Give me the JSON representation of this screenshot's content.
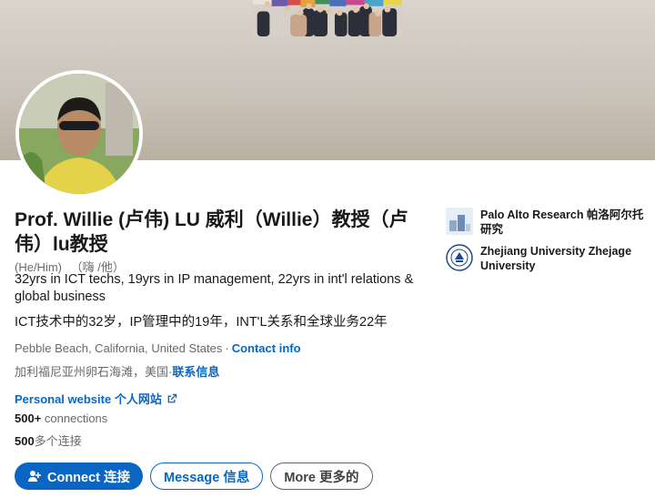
{
  "profile": {
    "name": "Prof. Willie (卢伟) LU 威利（Willie）教授（卢伟）lu教授",
    "pronouns": "(He/Him)",
    "pronouns_cn": "（嗨 /他）",
    "headline": "32yrs in ICT techs, 19yrs in IP management, 22yrs in int'l relations & global business",
    "headline_cn": "ICT技术中的32岁，IP管理中的19年，INT'L关系和全球业务22年",
    "location": "Pebble Beach, California, United States",
    "contact_label": "Contact info",
    "location_cn": "加利福尼亚州卵石海滩，美国·",
    "contact_label_cn": "联系信息",
    "website_label": "Personal website  个人网站",
    "connections_count": "500+",
    "connections_label": " connections",
    "connections_count_cn": "500",
    "connections_label_cn": "多个连接"
  },
  "actions": {
    "connect": "Connect  连接",
    "message": "Message  信息",
    "more": "More  更多的"
  },
  "organizations": [
    {
      "name": "Palo Alto Research  帕洛阿尔托研究"
    },
    {
      "name": "Zhejiang University  Zhejage University"
    }
  ],
  "colors": {
    "accent": "#0a66c2"
  }
}
